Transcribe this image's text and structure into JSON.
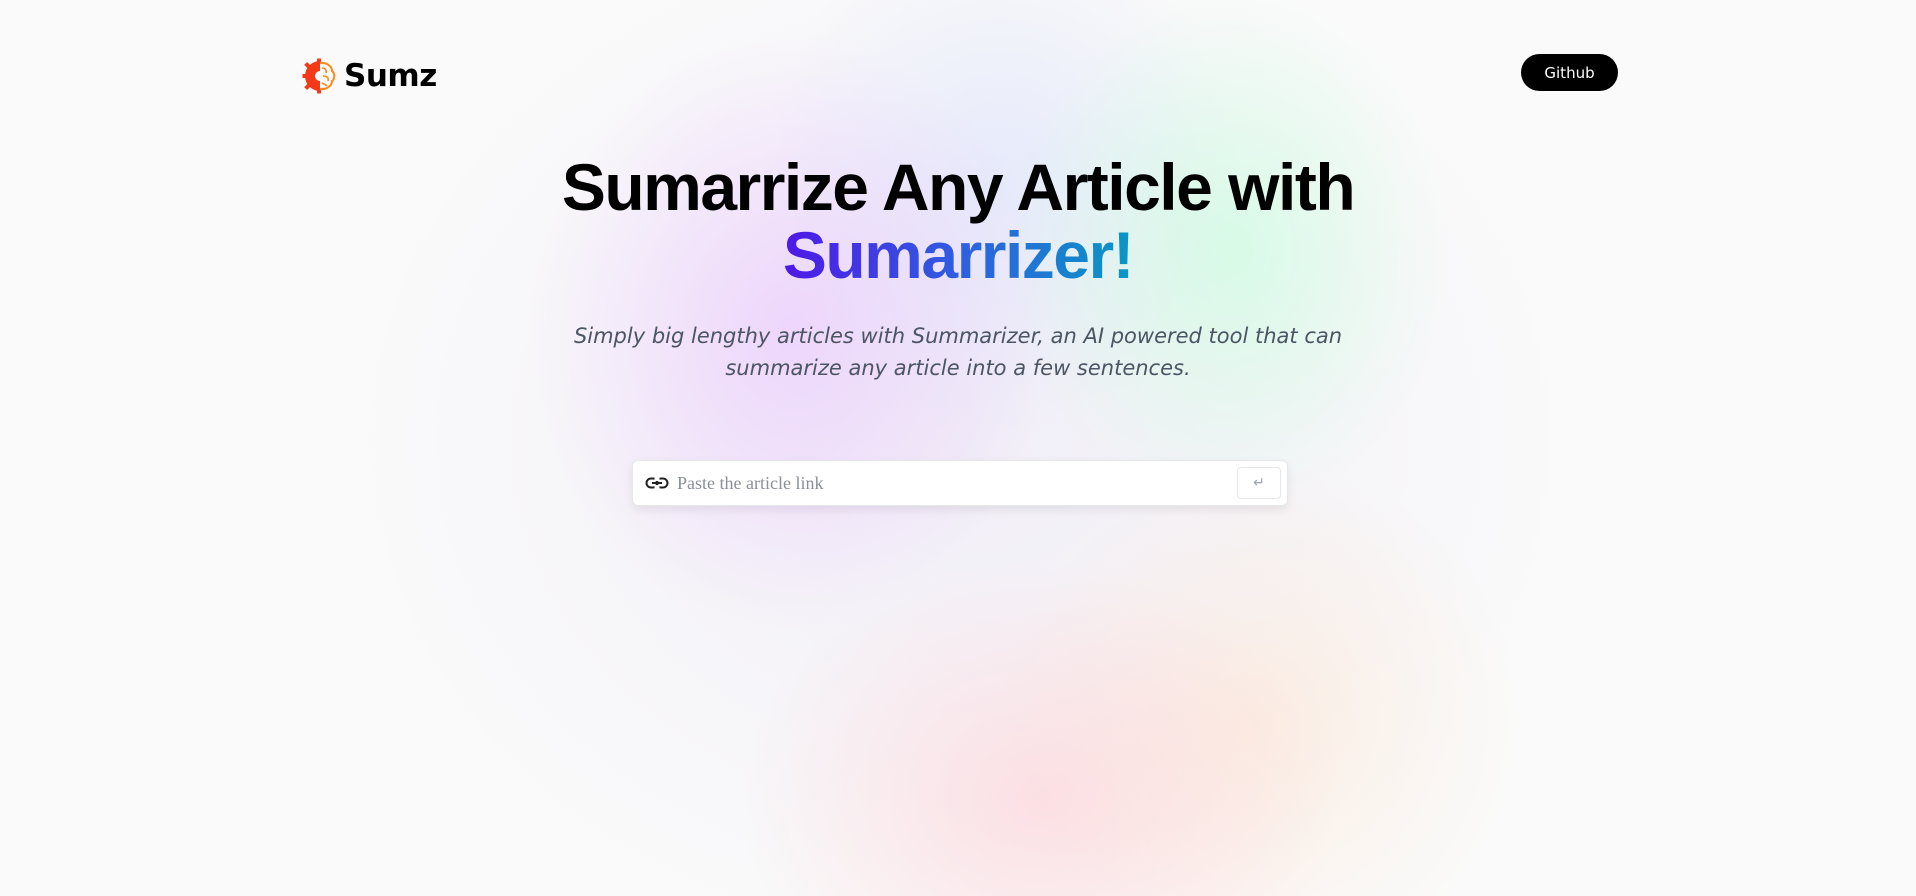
{
  "header": {
    "logo_text": "Sumz",
    "logo_icon": "brain-gear-icon",
    "github_label": "Github"
  },
  "hero": {
    "title_line1": "Sumarrize Any Article with",
    "title_accent": "Sumarrizer!",
    "subtitle": "Simply big lengthy articles with Summarizer, an AI powered tool that can summarize any article into a few sentences."
  },
  "search": {
    "placeholder": "Paste the article link",
    "value": "",
    "icon": "link-icon",
    "submit_symbol": "↵"
  },
  "colors": {
    "accent_start": "#4f18e6",
    "accent_end": "#0a97c4",
    "logo_orange": "#ff6b00",
    "button_bg": "#000000"
  }
}
